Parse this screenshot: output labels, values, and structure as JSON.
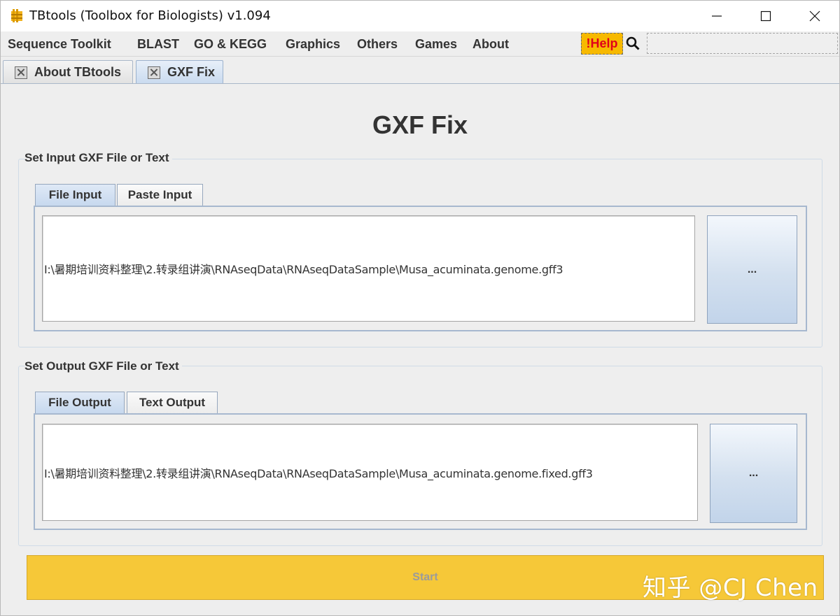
{
  "window": {
    "title": "TBtools (Toolbox for Biologists) v1.094",
    "icon": "tbtools-app-icon",
    "controls": {
      "minimize": "minimize-icon",
      "maximize": "maximize-icon",
      "close": "close-icon"
    }
  },
  "menubar": {
    "items": [
      "Sequence Toolkit",
      "BLAST",
      "GO & KEGG",
      "Graphics",
      "Others",
      "Games",
      "About"
    ],
    "help_label": "!Help",
    "search_icon": "search-icon",
    "search_value": ""
  },
  "doc_tabs": [
    {
      "label": "About TBtools",
      "active": false
    },
    {
      "label": "GXF Fix",
      "active": true
    }
  ],
  "page": {
    "title": "GXF Fix",
    "input_group": {
      "title": "Set Input GXF File or Text",
      "tabs": [
        "File Input",
        "Paste Input"
      ],
      "active_tab": "File Input",
      "path_value": "I:\\暑期培训资料整理\\2.转录组讲演\\RNAseqData\\RNAseqDataSample\\Musa_acuminata.genome.gff3",
      "browse_label": "..."
    },
    "output_group": {
      "title": "Set Output GXF File or Text",
      "tabs": [
        "File Output",
        "Text Output"
      ],
      "active_tab": "File Output",
      "path_value": "I:\\暑期培训资料整理\\2.转录组讲演\\RNAseqData\\RNAseqDataSample\\Musa_acuminata.genome.fixed.gff3",
      "browse_label": "..."
    },
    "start_label": "Start",
    "watermark": "知乎 @CJ Chen"
  },
  "colors": {
    "start_button": "#f6c838",
    "help_button": "#f7b900",
    "help_text": "#e0001a",
    "active_tab": "#c9daef"
  }
}
